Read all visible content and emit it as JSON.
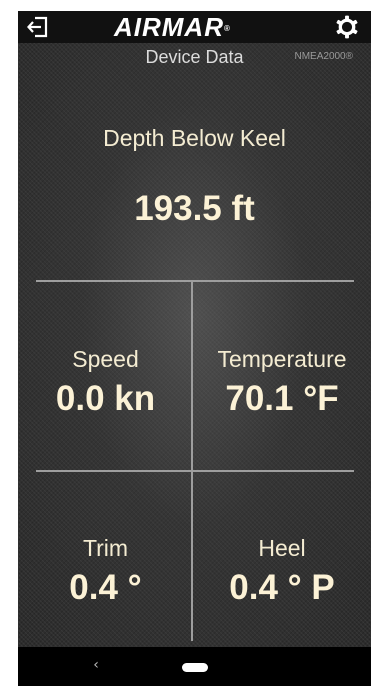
{
  "header": {
    "logo_text": "AIRMAR",
    "logo_mark": "®",
    "logout_icon": "logout-icon",
    "settings_icon": "gear-icon"
  },
  "subheader": {
    "title": "Device Data",
    "protocol": "NMEA2000®"
  },
  "primary": {
    "label": "Depth Below Keel",
    "value": "193.5 ft"
  },
  "tiles": {
    "speed": {
      "label": "Speed",
      "value": "0.0 kn"
    },
    "temperature": {
      "label": "Temperature",
      "value": "70.1 °F"
    },
    "trim": {
      "label": "Trim",
      "value": "0.4 °"
    },
    "heel": {
      "label": "Heel",
      "value": "0.4 ° P"
    }
  },
  "navbar": {
    "back_glyph": "‹",
    "back_icon": "back-chevron-icon",
    "home_icon": "home-pill-icon"
  }
}
